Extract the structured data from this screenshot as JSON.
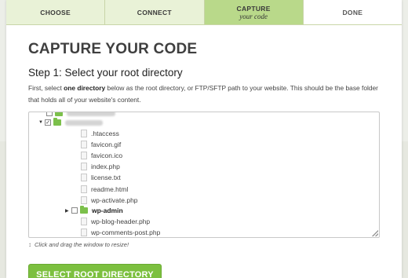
{
  "steps": [
    {
      "label": "CHOOSE",
      "sub": ""
    },
    {
      "label": "CONNECT",
      "sub": ""
    },
    {
      "label": "CAPTURE",
      "sub": "your code"
    },
    {
      "label": "DONE",
      "sub": ""
    }
  ],
  "page_title": "CAPTURE YOUR CODE",
  "step_heading": "Step 1: Select your root directory",
  "description": {
    "before": "First, select ",
    "bold": "one directory",
    "after": " below as the root directory, or FTP/SFTP path to your website. This should be the base folder that holds all of your website's content."
  },
  "tree": {
    "files": [
      ".htaccess",
      "favicon.gif",
      "favicon.ico",
      "index.php",
      "license.txt",
      "readme.html",
      "wp-activate.php"
    ],
    "subfolder": "wp-admin",
    "files_after": [
      "wp-blog-header.php",
      "wp-comments-post.php"
    ]
  },
  "resize_hint": "Click and drag the window to resize!",
  "primary_button": "SELECT ROOT DIRECTORY",
  "colors": {
    "accent": "#7cc03f",
    "active_step": "#b9d98a",
    "inactive_step": "#e9f2d7"
  }
}
